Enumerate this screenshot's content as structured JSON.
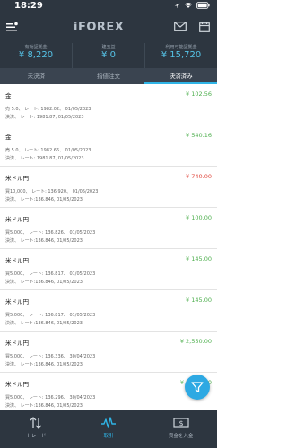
{
  "status_bar": {
    "time": "18:29"
  },
  "header": {
    "logo": "iFOREX"
  },
  "summary": [
    {
      "label": "有効証拠金",
      "value": "¥ 8,220"
    },
    {
      "label": "建玉益",
      "value": "¥ 0"
    },
    {
      "label": "利用可能証拠金",
      "value": "¥ 15,720"
    }
  ],
  "tabs": [
    {
      "label": "未決済"
    },
    {
      "label": "指値注文"
    },
    {
      "label": "決済済み"
    }
  ],
  "trades": [
    {
      "name": "金",
      "pnl": "¥ 102.56",
      "sign": "pos",
      "line1": "売 5.0、 レート: 1982.02、 01/05/2023",
      "line2": "決済、 レート: 1981.87, 01/05/2023"
    },
    {
      "name": "金",
      "pnl": "¥ 540.16",
      "sign": "pos",
      "line1": "売 5.0、 レート: 1982.66、 01/05/2023",
      "line2": "決済、 レート: 1981.87, 01/05/2023"
    },
    {
      "name": "米ドル円",
      "pnl": "-¥ 740.00",
      "sign": "neg",
      "line1": "買10,000、 レート: 136.920、 01/05/2023",
      "line2": "決済、 レート:136.846, 01/05/2023"
    },
    {
      "name": "米ドル円",
      "pnl": "¥ 100.00",
      "sign": "pos",
      "line1": "買5,000、 レート: 136.826、 01/05/2023",
      "line2": "決済、 レート:136.846, 01/05/2023"
    },
    {
      "name": "米ドル円",
      "pnl": "¥ 145.00",
      "sign": "pos",
      "line1": "買5,000、 レート: 136.817、 01/05/2023",
      "line2": "決済、 レート:136.846, 01/05/2023"
    },
    {
      "name": "米ドル円",
      "pnl": "¥ 145.00",
      "sign": "pos",
      "line1": "買5,000、 レート: 136.817、 01/05/2023",
      "line2": "決済、 レート:136.846, 01/05/2023"
    },
    {
      "name": "米ドル円",
      "pnl": "¥ 2,550.00",
      "sign": "pos",
      "line1": "買5,000、 レート: 136.336、 30/04/2023",
      "line2": "決済、 レート:136.846, 01/05/2023"
    },
    {
      "name": "米ドル円",
      "pnl": "¥ 2,750.00",
      "sign": "pos",
      "line1": "買5,000、 レート: 136.296、 30/04/2023",
      "line2": "決済、 レート:136.846, 01/05/2023"
    }
  ],
  "bottom_nav": [
    {
      "label": "トレード"
    },
    {
      "label": "取引"
    },
    {
      "label": "資金を入金"
    }
  ],
  "colors": {
    "header_bg": "#2d3640",
    "accent": "#2fb4e6",
    "positive": "#4cae4c",
    "negative": "#e0443a"
  },
  "icons": [
    "menu-icon",
    "mail-icon",
    "calendar-icon",
    "filter-icon",
    "trade-arrows-icon",
    "pulse-icon",
    "deposit-icon",
    "location-icon",
    "wifi-icon",
    "battery-icon"
  ]
}
